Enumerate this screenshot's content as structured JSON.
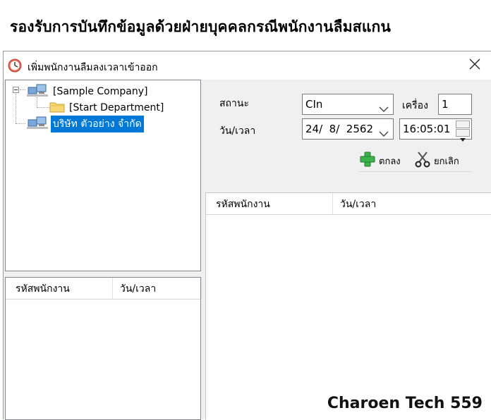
{
  "page": {
    "heading": "รองรับการบันทึกข้อมูลด้วยฝ่ายบุคคลกรณีพนักงานลืมสแกน",
    "watermark": "Charoen Tech 559"
  },
  "window": {
    "title": "เพิ่มพนักงานลืมลงเวลาเข้าออก",
    "icon": "clock-icon",
    "close_icon": "close-icon"
  },
  "tree": {
    "nodes": [
      {
        "label": "[Sample Company]",
        "icon": "computer-network-icon"
      },
      {
        "label": "[Start Department]",
        "icon": "folder-icon"
      },
      {
        "label": "บริษัท ตัวอย่าง จำกัด",
        "icon": "computer-network-icon",
        "selected": true
      }
    ]
  },
  "left_list": {
    "columns": [
      "รหัสพนักงาน",
      "วัน/เวลา"
    ]
  },
  "form": {
    "status_label": "สถานะ",
    "status_value": "CIn",
    "machine_label": "เครื่อง",
    "machine_value": "1",
    "datetime_label": "วัน/เวลา",
    "date_value": "24/  8/  2562",
    "time_value": "16:05:01"
  },
  "toolbar": {
    "ok_label": "ตกลง",
    "ok_icon": "plus-icon",
    "cancel_label": "ยกเลิก",
    "cancel_icon": "scissors-icon"
  },
  "right_list": {
    "columns": [
      "รหัสพนักงาน",
      "วัน/เวลา"
    ]
  },
  "colors": {
    "selection": "#0078d7",
    "window_bg": "#f0f0f0",
    "ok_icon_green": "#3bb54a"
  }
}
